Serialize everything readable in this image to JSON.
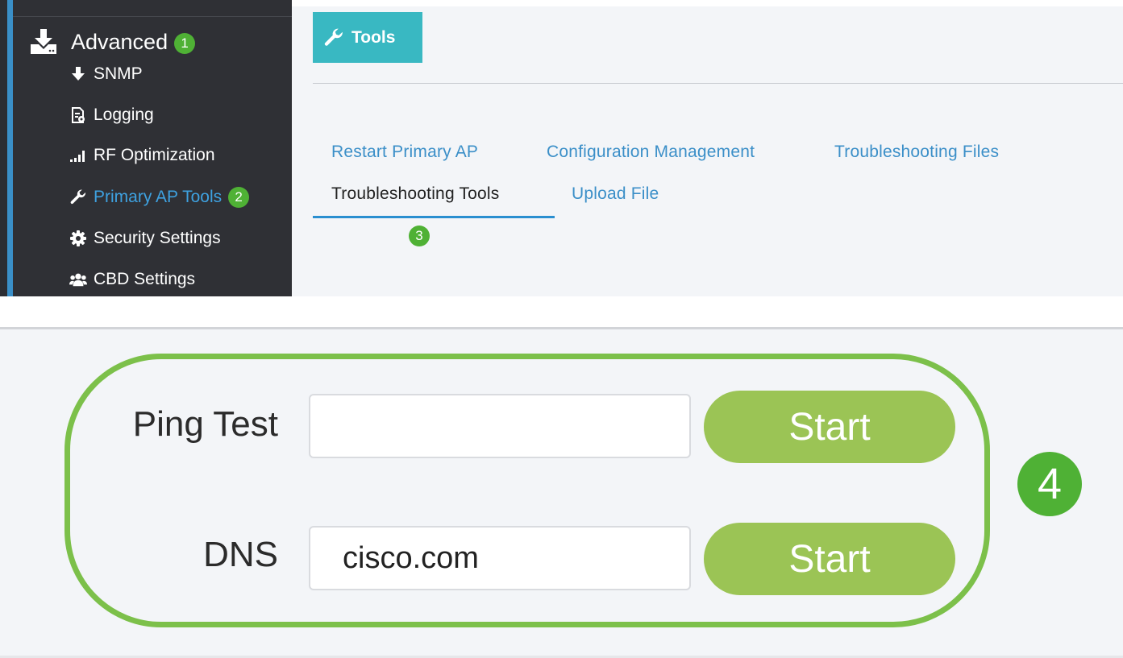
{
  "colors": {
    "sidebar_bg": "#2f3035",
    "sidebar_accent": "#3a8fc8",
    "active_link": "#3ea1e0",
    "link": "#3b8fc8",
    "tools_header_bg": "#39b8c2",
    "step_badge": "#4fb135",
    "start_button": "#9bc455",
    "highlight_frame": "#7cc04a"
  },
  "sidebar": {
    "header": {
      "label": "Advanced",
      "icon": "download-icon",
      "step": "1"
    },
    "items": [
      {
        "label": "SNMP",
        "icon": "arrow-down-icon"
      },
      {
        "label": "Logging",
        "icon": "file-gear-icon"
      },
      {
        "label": "RF Optimization",
        "icon": "signal-bars-icon"
      },
      {
        "label": "Primary AP Tools",
        "icon": "wrench-icon",
        "step": "2"
      },
      {
        "label": "Security Settings",
        "icon": "gear-icon"
      },
      {
        "label": "CBD Settings",
        "icon": "users-icon"
      }
    ]
  },
  "page_header": {
    "label": "Tools",
    "icon": "wrench-icon"
  },
  "tabs": [
    {
      "label": "Restart Primary AP"
    },
    {
      "label": "Configuration Management"
    },
    {
      "label": "Troubleshooting Files"
    },
    {
      "label": "Troubleshooting Tools",
      "active": true,
      "step": "3"
    },
    {
      "label": "Upload File"
    }
  ],
  "tools": {
    "ping": {
      "label": "Ping Test",
      "value": "",
      "button": "Start"
    },
    "dns": {
      "label": "DNS",
      "value": "cisco.com",
      "button": "Start"
    },
    "step": "4"
  }
}
